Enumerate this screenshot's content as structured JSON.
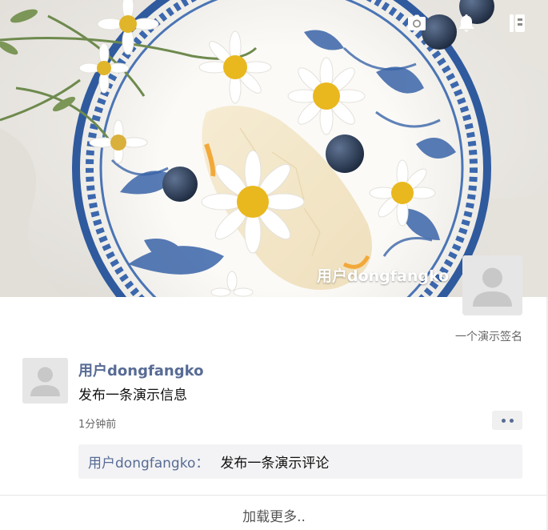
{
  "header": {
    "icons": [
      "camera-icon",
      "bell-icon",
      "contacts-book-icon"
    ],
    "username": "用户dongfangko",
    "signature": "一个演示签名"
  },
  "post": {
    "username": "用户dongfangko",
    "text": "发布一条演示信息",
    "time": "1分钟前",
    "comments": [
      {
        "username": "用户dongfangko",
        "separator": "：",
        "text": "发布一条演示评论"
      }
    ]
  },
  "footer": {
    "load_more": "加载更多.."
  },
  "colors": {
    "link": "#576b95",
    "comment_bg": "#f3f3f5",
    "avatar_bg": "#e6e6e6"
  }
}
